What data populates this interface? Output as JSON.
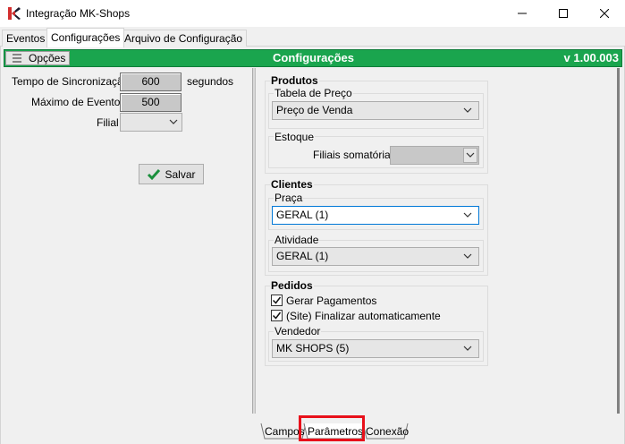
{
  "window": {
    "title": "Integração MK-Shops",
    "controls": [
      "minimize",
      "maximize",
      "close"
    ]
  },
  "tabs": [
    {
      "label": "Eventos",
      "active": false
    },
    {
      "label": "Configurações",
      "active": true
    },
    {
      "label": "Arquivo de Configuração",
      "active": false
    }
  ],
  "header": {
    "options_label": "Opções",
    "title": "Configurações",
    "version": "v 1.00.003",
    "color": "#1aa54e"
  },
  "left": {
    "sync_label": "Tempo de Sincronização",
    "sync_value": "600",
    "sync_unit": "segundos",
    "max_events_label": "Máximo de Eventos",
    "max_events_value": "500",
    "branch_label": "Filial",
    "branch_value": "",
    "save_label": "Salvar"
  },
  "produtos": {
    "title": "Produtos",
    "price_table_label": "Tabela de Preço",
    "price_table_value": "Preço de Venda",
    "stock_label": "Estoque",
    "branches_sum_label": "Filiais somatórias",
    "branches_sum_value": ""
  },
  "clientes": {
    "title": "Clientes",
    "praca_label": "Praça",
    "praca_value": "GERAL (1)",
    "atividade_label": "Atividade",
    "atividade_value": "GERAL (1)"
  },
  "pedidos": {
    "title": "Pedidos",
    "gerar_pagamentos_label": "Gerar Pagamentos",
    "gerar_pagamentos_checked": true,
    "finalizar_label": "(Site) Finalizar automaticamente",
    "finalizar_checked": true,
    "vendedor_label": "Vendedor",
    "vendedor_value": "MK SHOPS (5)"
  },
  "bottom_tabs": [
    {
      "label": "Campos",
      "active": false
    },
    {
      "label": "Parâmetros",
      "active": true,
      "highlighted": true
    },
    {
      "label": "Conexão",
      "active": false
    }
  ],
  "colors": {
    "highlight": "#e8101a",
    "focus_border": "#0078d7",
    "check_green": "#1a8f3c"
  }
}
